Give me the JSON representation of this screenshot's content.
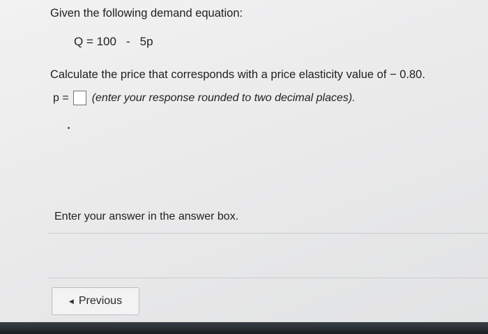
{
  "question": {
    "intro": "Given the following demand equation:",
    "equation_left": "Q = 100",
    "equation_op": "-",
    "equation_right": "5p",
    "task": "Calculate the price that corresponds with a price elasticity value of − 0.80.",
    "answer_label": "p =",
    "answer_value": "",
    "answer_hint": "(enter your response rounded to two decimal places)."
  },
  "instruction": "Enter your answer in the answer box.",
  "nav": {
    "previous_icon": "caret-left-icon",
    "previous_label": "Previous"
  }
}
